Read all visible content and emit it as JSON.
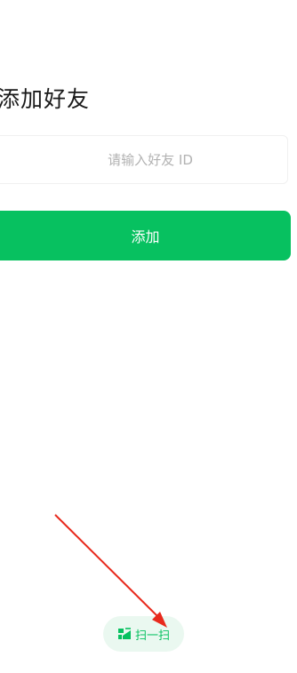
{
  "page": {
    "title": "添加好友"
  },
  "form": {
    "friend_id_placeholder": "请输入好友 ID",
    "friend_id_value": "",
    "add_label": "添加"
  },
  "scan": {
    "label": "扫一扫",
    "icon": "scan-qr-icon"
  },
  "colors": {
    "accent": "#07c160",
    "accent_light": "#eaf8f0",
    "annotation": "#e8291c"
  }
}
